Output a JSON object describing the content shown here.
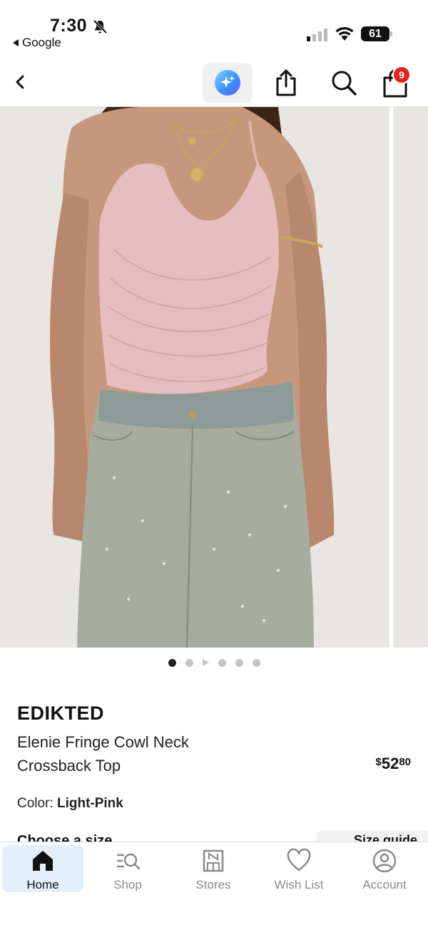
{
  "status_bar": {
    "time": "7:30",
    "back_app_label": "Google",
    "battery": "61"
  },
  "top_nav": {
    "cart_count": "9"
  },
  "carousel": {
    "dots_before": 2,
    "dots_after": 3,
    "active_index": 0
  },
  "product": {
    "brand": "EDIKTED",
    "name": "Elenie Fringe Cowl Neck Crossback Top",
    "price": {
      "currency": "$",
      "dollars": "52",
      "cents": "80"
    },
    "color_label": "Color:",
    "color_value": "Light-Pink",
    "size_label": "Choose a size",
    "size_guide_label": "Size guide"
  },
  "tab_bar": {
    "items": [
      {
        "label": "Home",
        "icon": "home-icon",
        "active": true
      },
      {
        "label": "Shop",
        "icon": "shop-search-icon",
        "active": false
      },
      {
        "label": "Stores",
        "icon": "store-icon",
        "active": false
      },
      {
        "label": "Wish List",
        "icon": "heart-icon",
        "active": false
      },
      {
        "label": "Account",
        "icon": "account-icon",
        "active": false
      }
    ]
  },
  "colors": {
    "accent_badge": "#e2231a",
    "active_tab_bg": "#e3f0fc",
    "image_bg": "#e8e6e1"
  }
}
